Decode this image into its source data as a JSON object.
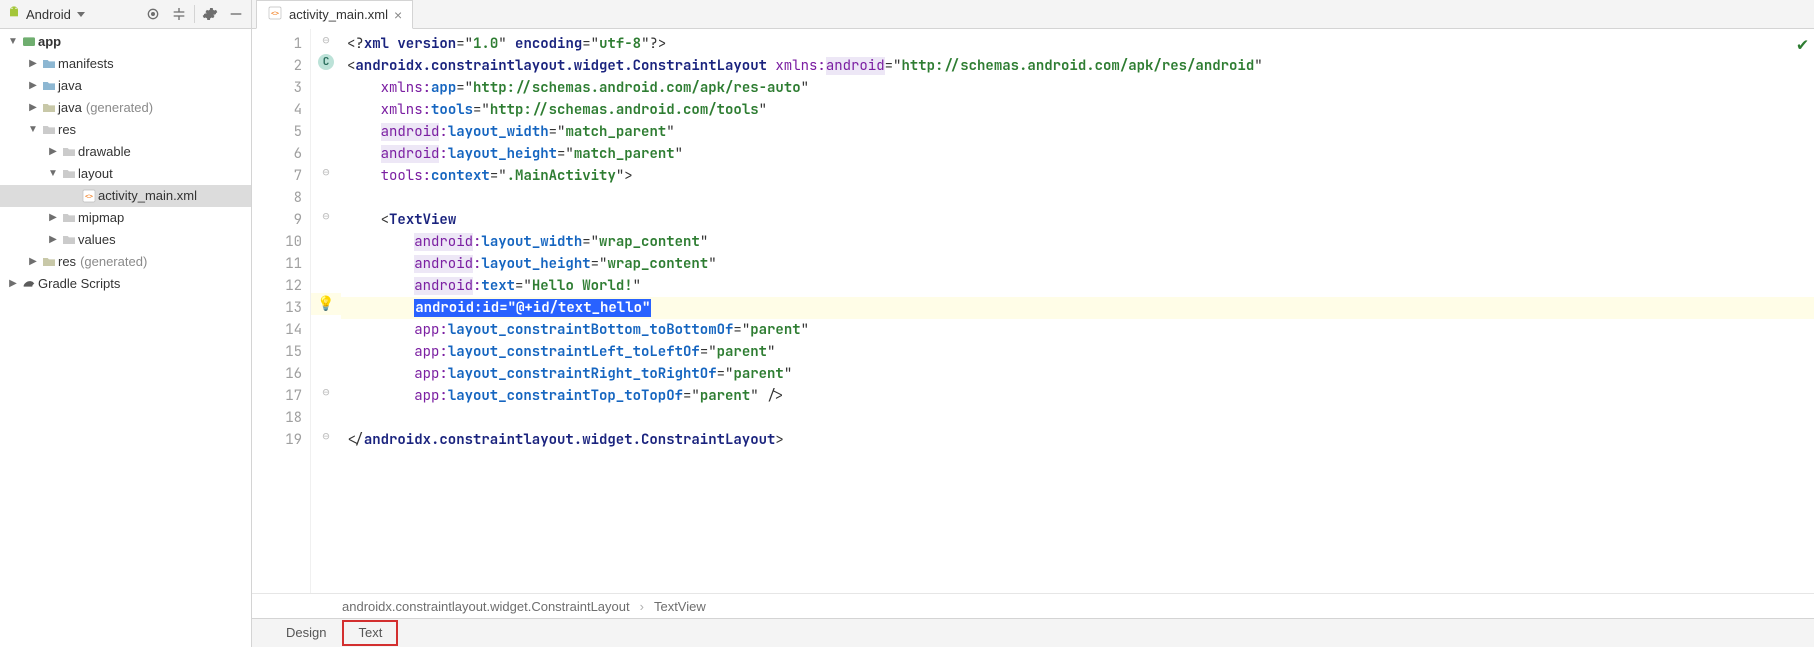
{
  "project": {
    "mode_label": "Android",
    "tree": [
      {
        "depth": 0,
        "arrow": "down",
        "icon": "module",
        "label": "app",
        "bold": true
      },
      {
        "depth": 1,
        "arrow": "right",
        "icon": "folder",
        "label": "manifests"
      },
      {
        "depth": 1,
        "arrow": "right",
        "icon": "folder",
        "label": "java"
      },
      {
        "depth": 1,
        "arrow": "right",
        "icon": "folder-gen",
        "label": "java",
        "note": "(generated)"
      },
      {
        "depth": 1,
        "arrow": "down",
        "icon": "folder-res",
        "label": "res"
      },
      {
        "depth": 2,
        "arrow": "right",
        "icon": "folder-res",
        "label": "drawable"
      },
      {
        "depth": 2,
        "arrow": "down",
        "icon": "folder-res",
        "label": "layout"
      },
      {
        "depth": 3,
        "arrow": "",
        "icon": "xml",
        "label": "activity_main.xml",
        "selected": true
      },
      {
        "depth": 2,
        "arrow": "right",
        "icon": "folder-res",
        "label": "mipmap"
      },
      {
        "depth": 2,
        "arrow": "right",
        "icon": "folder-res",
        "label": "values"
      },
      {
        "depth": 1,
        "arrow": "right",
        "icon": "folder-gen",
        "label": "res",
        "note": "(generated)"
      },
      {
        "depth": 0,
        "arrow": "right",
        "icon": "gradle",
        "label": "Gradle Scripts"
      }
    ]
  },
  "editor": {
    "tab": {
      "filename": "activity_main.xml"
    },
    "selected_line": 13,
    "change_marker_line": 2,
    "line_count": 19,
    "lines": {
      "1": [
        {
          "c": "tok-punc",
          "t": "<?"
        },
        {
          "c": "tok-tag",
          "t": "xml version"
        },
        {
          "c": "tok-punc",
          "t": "=\""
        },
        {
          "c": "tok-str",
          "t": "1.0"
        },
        {
          "c": "tok-punc",
          "t": "\" "
        },
        {
          "c": "tok-tag",
          "t": "encoding"
        },
        {
          "c": "tok-punc",
          "t": "=\""
        },
        {
          "c": "tok-str",
          "t": "utf-8"
        },
        {
          "c": "tok-punc",
          "t": "\"?>"
        }
      ],
      "2": [
        {
          "c": "tok-punc",
          "t": "<"
        },
        {
          "c": "tok-tag",
          "t": "androidx.constraintlayout.widget.ConstraintLayout "
        },
        {
          "c": "tok-ns",
          "t": "xmlns:"
        },
        {
          "c": "tok-nshl",
          "t": "android"
        },
        {
          "c": "tok-punc",
          "t": "=\""
        },
        {
          "c": "tok-str",
          "t": "http://schemas.android.com/apk/res/android"
        },
        {
          "c": "tok-punc",
          "t": "\""
        }
      ],
      "3": [
        {
          "c": "",
          "t": "    "
        },
        {
          "c": "tok-ns",
          "t": "xmlns:"
        },
        {
          "c": "tok-attr",
          "t": "app"
        },
        {
          "c": "tok-punc",
          "t": "=\""
        },
        {
          "c": "tok-str",
          "t": "http://schemas.android.com/apk/res-auto"
        },
        {
          "c": "tok-punc",
          "t": "\""
        }
      ],
      "4": [
        {
          "c": "",
          "t": "    "
        },
        {
          "c": "tok-ns",
          "t": "xmlns:"
        },
        {
          "c": "tok-attr",
          "t": "tools"
        },
        {
          "c": "tok-punc",
          "t": "=\""
        },
        {
          "c": "tok-str",
          "t": "http://schemas.android.com/tools"
        },
        {
          "c": "tok-punc",
          "t": "\""
        }
      ],
      "5": [
        {
          "c": "",
          "t": "    "
        },
        {
          "c": "tok-nshl",
          "t": "android"
        },
        {
          "c": "tok-ns",
          "t": ":"
        },
        {
          "c": "tok-attr",
          "t": "layout_width"
        },
        {
          "c": "tok-punc",
          "t": "=\""
        },
        {
          "c": "tok-str",
          "t": "match_parent"
        },
        {
          "c": "tok-punc",
          "t": "\""
        }
      ],
      "6": [
        {
          "c": "",
          "t": "    "
        },
        {
          "c": "tok-nshl",
          "t": "android"
        },
        {
          "c": "tok-ns",
          "t": ":"
        },
        {
          "c": "tok-attr",
          "t": "layout_height"
        },
        {
          "c": "tok-punc",
          "t": "=\""
        },
        {
          "c": "tok-str",
          "t": "match_parent"
        },
        {
          "c": "tok-punc",
          "t": "\""
        }
      ],
      "7": [
        {
          "c": "",
          "t": "    "
        },
        {
          "c": "tok-ns",
          "t": "tools:"
        },
        {
          "c": "tok-attr",
          "t": "context"
        },
        {
          "c": "tok-punc",
          "t": "=\""
        },
        {
          "c": "tok-str",
          "t": ".MainActivity"
        },
        {
          "c": "tok-punc",
          "t": "\">"
        }
      ],
      "8": [
        {
          "c": "",
          "t": ""
        }
      ],
      "9": [
        {
          "c": "",
          "t": "    "
        },
        {
          "c": "tok-punc",
          "t": "<"
        },
        {
          "c": "tok-tag",
          "t": "TextView"
        }
      ],
      "10": [
        {
          "c": "",
          "t": "        "
        },
        {
          "c": "tok-nshl",
          "t": "android"
        },
        {
          "c": "tok-ns",
          "t": ":"
        },
        {
          "c": "tok-attr",
          "t": "layout_width"
        },
        {
          "c": "tok-punc",
          "t": "=\""
        },
        {
          "c": "tok-str",
          "t": "wrap_content"
        },
        {
          "c": "tok-punc",
          "t": "\""
        }
      ],
      "11": [
        {
          "c": "",
          "t": "        "
        },
        {
          "c": "tok-nshl",
          "t": "android"
        },
        {
          "c": "tok-ns",
          "t": ":"
        },
        {
          "c": "tok-attr",
          "t": "layout_height"
        },
        {
          "c": "tok-punc",
          "t": "=\""
        },
        {
          "c": "tok-str",
          "t": "wrap_content"
        },
        {
          "c": "tok-punc",
          "t": "\""
        }
      ],
      "12": [
        {
          "c": "",
          "t": "        "
        },
        {
          "c": "tok-nshl",
          "t": "android"
        },
        {
          "c": "tok-ns",
          "t": ":"
        },
        {
          "c": "tok-attr",
          "t": "text"
        },
        {
          "c": "tok-punc",
          "t": "=\""
        },
        {
          "c": "tok-str",
          "t": "Hello World!"
        },
        {
          "c": "tok-punc",
          "t": "\""
        }
      ],
      "13": [
        {
          "c": "",
          "t": "        "
        },
        {
          "c": "tok-sel",
          "t": "android:id=\"@+id/text_hello\""
        }
      ],
      "14": [
        {
          "c": "",
          "t": "        "
        },
        {
          "c": "tok-ns",
          "t": "app:"
        },
        {
          "c": "tok-attr",
          "t": "layout_constraintBottom_toBottomOf"
        },
        {
          "c": "tok-punc",
          "t": "=\""
        },
        {
          "c": "tok-str",
          "t": "parent"
        },
        {
          "c": "tok-punc",
          "t": "\""
        }
      ],
      "15": [
        {
          "c": "",
          "t": "        "
        },
        {
          "c": "tok-ns",
          "t": "app:"
        },
        {
          "c": "tok-attr",
          "t": "layout_constraintLeft_toLeftOf"
        },
        {
          "c": "tok-punc",
          "t": "=\""
        },
        {
          "c": "tok-str",
          "t": "parent"
        },
        {
          "c": "tok-punc",
          "t": "\""
        }
      ],
      "16": [
        {
          "c": "",
          "t": "        "
        },
        {
          "c": "tok-ns",
          "t": "app:"
        },
        {
          "c": "tok-attr",
          "t": "layout_constraintRight_toRightOf"
        },
        {
          "c": "tok-punc",
          "t": "=\""
        },
        {
          "c": "tok-str",
          "t": "parent"
        },
        {
          "c": "tok-punc",
          "t": "\""
        }
      ],
      "17": [
        {
          "c": "",
          "t": "        "
        },
        {
          "c": "tok-ns",
          "t": "app:"
        },
        {
          "c": "tok-attr",
          "t": "layout_constraintTop_toTopOf"
        },
        {
          "c": "tok-punc",
          "t": "=\""
        },
        {
          "c": "tok-str",
          "t": "parent"
        },
        {
          "c": "tok-punc",
          "t": "\" />"
        }
      ],
      "18": [
        {
          "c": "",
          "t": ""
        }
      ],
      "19": [
        {
          "c": "tok-punc",
          "t": "</"
        },
        {
          "c": "tok-tag",
          "t": "androidx.constraintlayout.widget.ConstraintLayout"
        },
        {
          "c": "tok-punc",
          "t": ">"
        }
      ]
    }
  },
  "breadcrumb": {
    "seg1": "androidx.constraintlayout.widget.ConstraintLayout",
    "seg2": "TextView"
  },
  "bottom_tabs": {
    "design": "Design",
    "text": "Text",
    "selected": "text"
  }
}
